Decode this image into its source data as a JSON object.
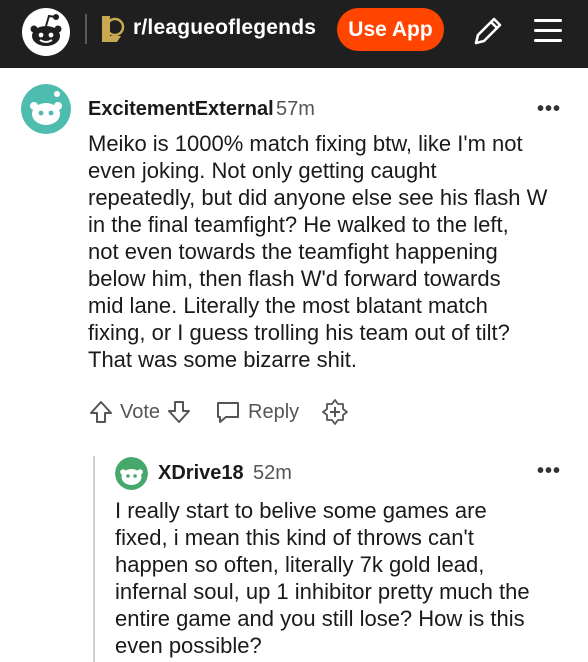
{
  "header": {
    "subreddit": "r/leagueoflegends",
    "use_app_label": "Use App",
    "icons": [
      "reddit-logo-icon",
      "league-icon",
      "pencil-icon",
      "menu-icon"
    ],
    "accent_color": "#ff4500"
  },
  "comments": [
    {
      "username": "ExcitementExternal",
      "time": "57m",
      "more": "•••",
      "body_lines": [
        "Meiko is 1000% match fixing btw, like I'm not",
        "even joking. Not only getting caught",
        "repeatedly, but did anyone else see his flash W",
        "in the final teamfight? He walked to the left,",
        "not even towards the teamfight happening",
        "below him, then flash W'd forward towards",
        "mid lane. Literally the most blatant match",
        "fixing, or I guess trolling his team out of tilt?",
        "That was some bizarre shit."
      ],
      "vote_label": "Vote",
      "reply_label": "Reply"
    },
    {
      "username": "XDrive18",
      "time": "52m",
      "more": "•••",
      "body_lines": [
        "I really start to belive some games are",
        "fixed, i mean this kind of throws can't",
        "happen so often, literally 7k gold lead,",
        "infernal soul, up 1 inhibitor pretty much the",
        "entire game and you still lose? How is this",
        "even possible?"
      ]
    }
  ]
}
